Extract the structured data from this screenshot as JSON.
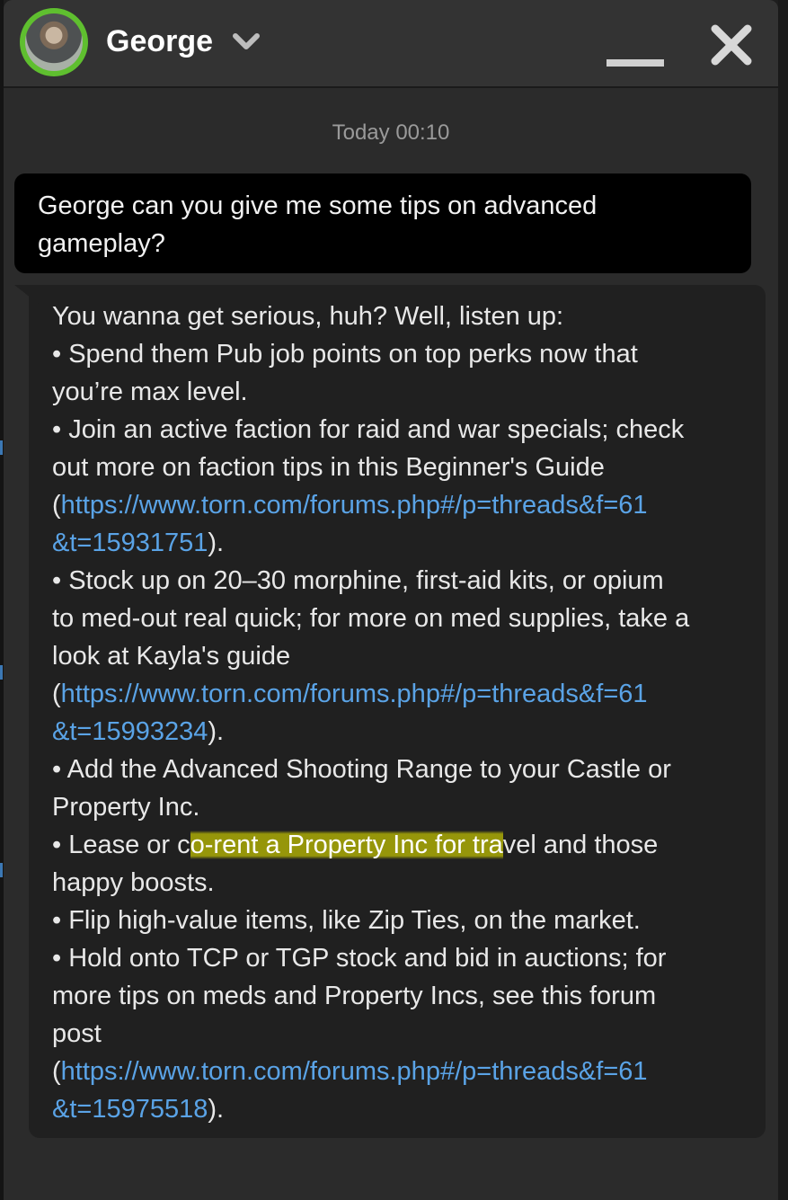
{
  "header": {
    "contact_name": "George",
    "avatar_icon": "user-photo-avatar",
    "status_ring_color": "#5fbf2f"
  },
  "timestamp": "Today 00:10",
  "outgoing_message": {
    "line1": "George can you give me some tips on advanced",
    "line2": "gameplay?"
  },
  "incoming_message": {
    "l1": "You wanna get serious, huh? Well, listen up:",
    "l2": "• Spend them Pub job points on top perks now that",
    "l3": "you’re max level.",
    "l4": "• Join an active faction for raid and war specials; check",
    "l5": "out more on faction tips in this Beginner's Guide",
    "link1_a": "https://www.torn.com/forums.php#/p=threads&f=61",
    "link1_b": "&t=15931751",
    "l8": "• Stock up on 20–30 morphine, first-aid kits, or opium",
    "l9": "to med-out real quick; for more on med supplies, take a",
    "l10": "look at Kayla's guide",
    "link2_a": "https://www.torn.com/forums.php#/p=threads&f=61",
    "link2_b": "&t=15993234",
    "l13": "• Add the Advanced Shooting Range to your Castle or",
    "l14": "Property Inc.",
    "l15_pre": "• Lease or c",
    "l15_hl": "o-rent a Property Inc for tra",
    "l15_post": "vel and those",
    "l16": "happy boosts.",
    "l17": "• Flip high-value items, like Zip Ties, on the market.",
    "l18": "• Hold onto TCP or TGP stock and bid in auctions; for",
    "l19": "more tips on meds and Property Incs, see this forum",
    "l20": "post",
    "link3_a": "https://www.torn.com/forums.php#/p=threads&f=61",
    "link3_b": "&t=15975518",
    "open_paren": "(",
    "close_paren": ").",
    "highlight_color": "#c8c800",
    "link_color": "#5aa3e6"
  }
}
